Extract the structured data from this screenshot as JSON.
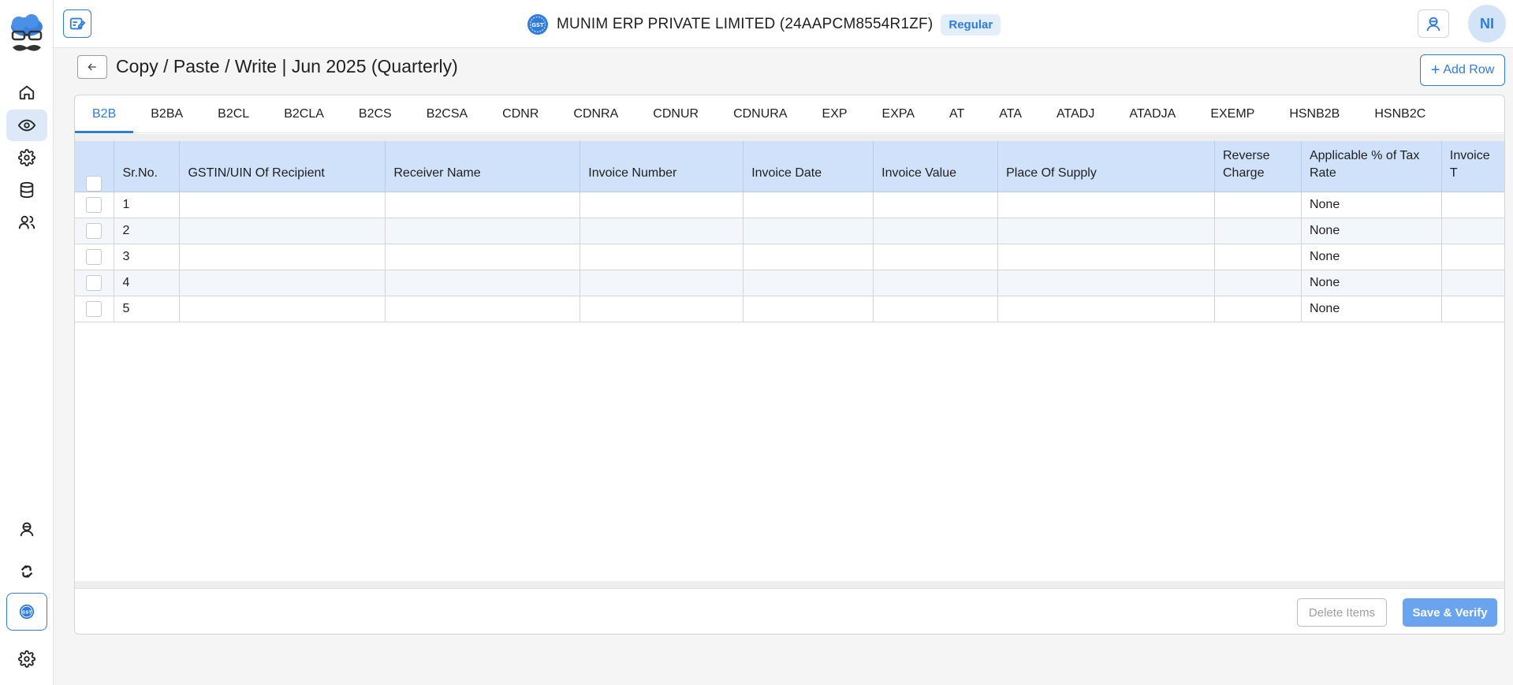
{
  "header": {
    "company_name": "MUNIM ERP PRIVATE LIMITED (24AAPCM8554R1ZF)",
    "badge": "Regular",
    "avatar_initials": "NI"
  },
  "sidebar": {
    "items": [
      {
        "icon": "home-icon"
      },
      {
        "icon": "eye-icon",
        "active": true
      },
      {
        "icon": "gear-icon"
      },
      {
        "icon": "database-icon"
      },
      {
        "icon": "users-icon"
      }
    ],
    "bottom_items": [
      {
        "icon": "support-agent-icon"
      },
      {
        "icon": "sync-icon"
      },
      {
        "icon": "gst-icon"
      },
      {
        "icon": "settings-icon"
      }
    ]
  },
  "page": {
    "title": "Copy / Paste / Write | Jun 2025 (Quarterly)",
    "add_row_label": "Add Row"
  },
  "tabs": [
    "B2B",
    "B2BA",
    "B2CL",
    "B2CLA",
    "B2CS",
    "B2CSA",
    "CDNR",
    "CDNRA",
    "CDNUR",
    "CDNURA",
    "EXP",
    "EXPA",
    "AT",
    "ATA",
    "ATADJ",
    "ATADJA",
    "EXEMP",
    "HSNB2B",
    "HSNB2C"
  ],
  "active_tab": "B2B",
  "table": {
    "columns": [
      "Sr.No.",
      "GSTIN/UIN Of Recipient",
      "Receiver Name",
      "Invoice Number",
      "Invoice Date",
      "Invoice Value",
      "Place Of Supply",
      "Reverse Charge",
      "Applicable % of Tax Rate",
      "Invoice T"
    ],
    "rows": [
      {
        "sr": "1",
        "tax_rate": "None"
      },
      {
        "sr": "2",
        "tax_rate": "None"
      },
      {
        "sr": "3",
        "tax_rate": "None"
      },
      {
        "sr": "4",
        "tax_rate": "None"
      },
      {
        "sr": "5",
        "tax_rate": "None"
      }
    ]
  },
  "footer": {
    "delete_label": "Delete Items",
    "save_label": "Save & Verify"
  },
  "colors": {
    "accent": "#2f7be0",
    "header_bg": "#cfe2fa",
    "save_btn": "#6aa4ef"
  }
}
